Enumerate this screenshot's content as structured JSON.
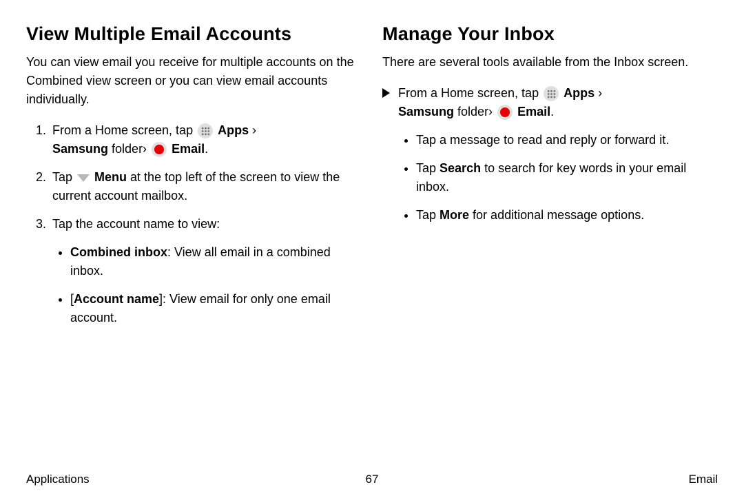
{
  "left": {
    "heading": "View Multiple Email Accounts",
    "intro": "You can view email you receive for multiple accounts on the Combined view screen or you can view email accounts individually.",
    "step1_pre": "From a Home screen, tap ",
    "apps_label": "Apps",
    "sep": " › ",
    "samsung_folder": "Samsung",
    "folder_word": " folder› ",
    "email_label": "Email",
    "period": ".",
    "step2_pre": "Tap ",
    "menu_label": "Menu",
    "step2_post": " at the top left of the screen to view the current account mailbox.",
    "step3": "Tap the account name to view:",
    "bullet_a_bold": "Combined inbox",
    "bullet_a_rest": ": View all email in a combined inbox.",
    "bullet_b_pre": "[",
    "bullet_b_bold": "Account name",
    "bullet_b_rest": "]: View email for only one email account."
  },
  "right": {
    "heading": "Manage Your Inbox",
    "intro": "There are several tools available from the Inbox screen.",
    "lead_pre": "From a Home screen, tap ",
    "apps_label": "Apps",
    "sep": " › ",
    "samsung_folder": "Samsung",
    "folder_word": " folder› ",
    "email_label": "Email",
    "period": ".",
    "b1": "Tap a message to read and reply or forward it.",
    "b2_pre": "Tap ",
    "b2_bold": "Search",
    "b2_post": " to search for key words in your email inbox.",
    "b3_pre": "Tap ",
    "b3_bold": "More",
    "b3_post": " for additional message options."
  },
  "footer": {
    "left": "Applications",
    "center": "67",
    "right": "Email"
  }
}
